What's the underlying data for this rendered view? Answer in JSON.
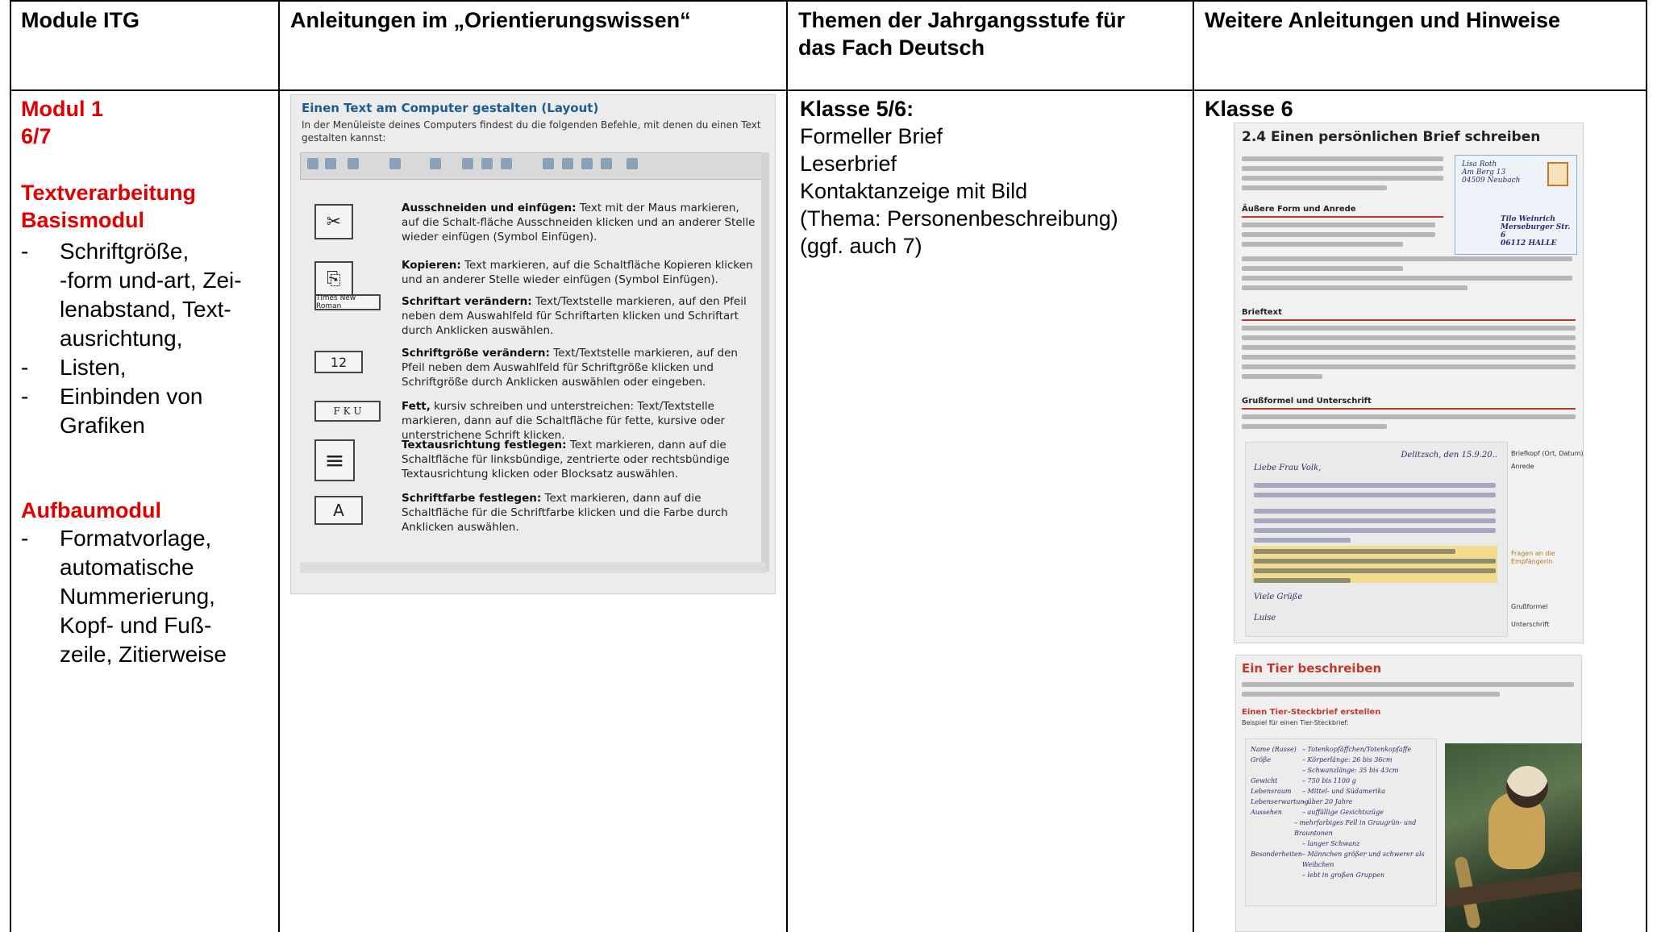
{
  "headers": {
    "col1": "Module ITG",
    "col2": "Anleitungen im „Orientierungswissen“",
    "col3_line1": "Themen der Jahrgangsstufe für",
    "col3_line2": "das Fach Deutsch",
    "col4": "Weitere Anleitungen und Hinweise"
  },
  "col1": {
    "module_title": "Modul 1",
    "module_grade": "6/7",
    "section1_line1": "Textverarbeitung",
    "section1_line2": "Basismodul",
    "basis_items": [
      "Schriftgröße,\n-form und-art, Zei-\nlenabstand, Text-\nausrichtung,",
      "Listen,",
      "Einbinden von\nGrafiken"
    ],
    "section2": "Aufbaumodul",
    "aufbau_items": [
      "Formatvorlage,\nautomatische\nNummerierung,\nKopf- und Fuß-\nzeile, Zitierweise"
    ]
  },
  "col3": {
    "class_title": "Klasse 5/6:",
    "lines": [
      "Formeller Brief",
      "Leserbrief",
      "Kontaktanzeige mit Bild",
      "(Thema: Personenbeschreibung)",
      "(ggf. auch 7)"
    ]
  },
  "col4": {
    "class_title": "Klasse 6"
  },
  "scan_layout": {
    "title": "Einen Text am Computer gestalten (Layout)",
    "intro_line1": "In der Menüleiste deines Computers findest du die folgenden Befehle, mit denen du einen Text",
    "intro_line2": "gestalten kannst:",
    "rows": [
      {
        "icon": "✂",
        "bold": "Ausschneiden und einfügen:",
        "text": " Text mit der Maus markieren, auf die Schalt-fläche Ausschneiden klicken und an anderer Stelle wieder einfügen (Symbol Einfügen)."
      },
      {
        "icon": "⎘",
        "bold": "Kopieren:",
        "text": " Text markieren, auf die Schaltfläche Kopieren klicken und an anderer Stelle wieder einfügen (Symbol Einfügen)."
      },
      {
        "icon": "Times New Roman",
        "bold": "Schriftart verändern:",
        "text": " Text/Textstelle markieren, auf den Pfeil neben dem Auswahlfeld für Schriftarten klicken und Schriftart durch Anklicken auswählen."
      },
      {
        "icon": "12",
        "bold": "Schriftgröße verändern:",
        "text": " Text/Textstelle markieren, auf den Pfeil neben dem Auswahlfeld für Schriftgröße klicken und Schriftgröße durch Anklicken auswählen oder eingeben."
      },
      {
        "icon": "F K U",
        "bold": "Fett,",
        "text": " kursiv schreiben und unterstreichen: Text/Textstelle markieren, dann auf die Schaltfläche für fette, kursive oder unterstrichene Schrift klicken."
      },
      {
        "icon": "≡",
        "bold": "Textausrichtung festlegen:",
        "text": " Text markieren, dann auf die Schaltfläche für linksbündige, zentrierte oder rechtsbündige Textausrichtung klicken oder Blocksatz auswählen."
      },
      {
        "icon": "A",
        "bold": "Schriftfarbe festlegen:",
        "text": " Text markieren, dann auf die Schaltfläche für die Schriftfarbe klicken und die Farbe durch Anklicken auswählen."
      }
    ]
  },
  "scan_brief": {
    "title": "2.4  Einen persönlichen Brief schreiben",
    "sub1": "Äußere Form und Anrede",
    "sub2": "Brieftext",
    "sub3": "Grußformel und Unterschrift",
    "address1": "Lisa Roth\nAm Berg 13\n04509 Neubach",
    "address2": "Tilo Weinrich\nMerseburger Str. 6\n06112 HALLE",
    "letter_date": "Delitzsch, den 15.9.20..",
    "letter_greeting": "Liebe Frau Volk,",
    "letter_close": "Viele Grüße",
    "letter_sign": "Luise",
    "margin_notes": [
      "Briefkopf (Ort, Datum)",
      "Anrede",
      "Fragen an die Empfängerin",
      "Grußformel",
      "Unterschrift"
    ]
  },
  "scan_tier": {
    "title": "Ein Tier beschreiben",
    "sub": "Einen Tier-Steckbrief erstellen",
    "sub_note": "Beispiel für einen Tier-Steckbrief:",
    "labels": [
      "Name (Rasse)",
      "Größe",
      "",
      "Gewicht",
      "Lebensraum",
      "Lebenserwartung",
      "Aussehen",
      "",
      "",
      "Besonderheiten",
      ""
    ],
    "values": [
      "– Totenkopfäffchen/Totenkopfaffe",
      "– Körperlänge: 26 bis 36cm",
      "– Schwanzlänge: 35 bis 43cm",
      "– 750 bis 1100 g",
      "– Mittel- und Südamerika",
      "– über 20 Jahre",
      "– auffällige Gesichtszüge",
      "– mehrfarbiges Fell in Graugrün- und Brauntonen",
      "– langer Schwanz",
      "– Männchen größer und schwerer als Weibchen",
      "– lebt in großen Gruppen"
    ]
  },
  "colors": {
    "accent_red": "#e00000",
    "scan_heading_blue": "#1c5b8f",
    "scan_red": "#c0392b"
  }
}
